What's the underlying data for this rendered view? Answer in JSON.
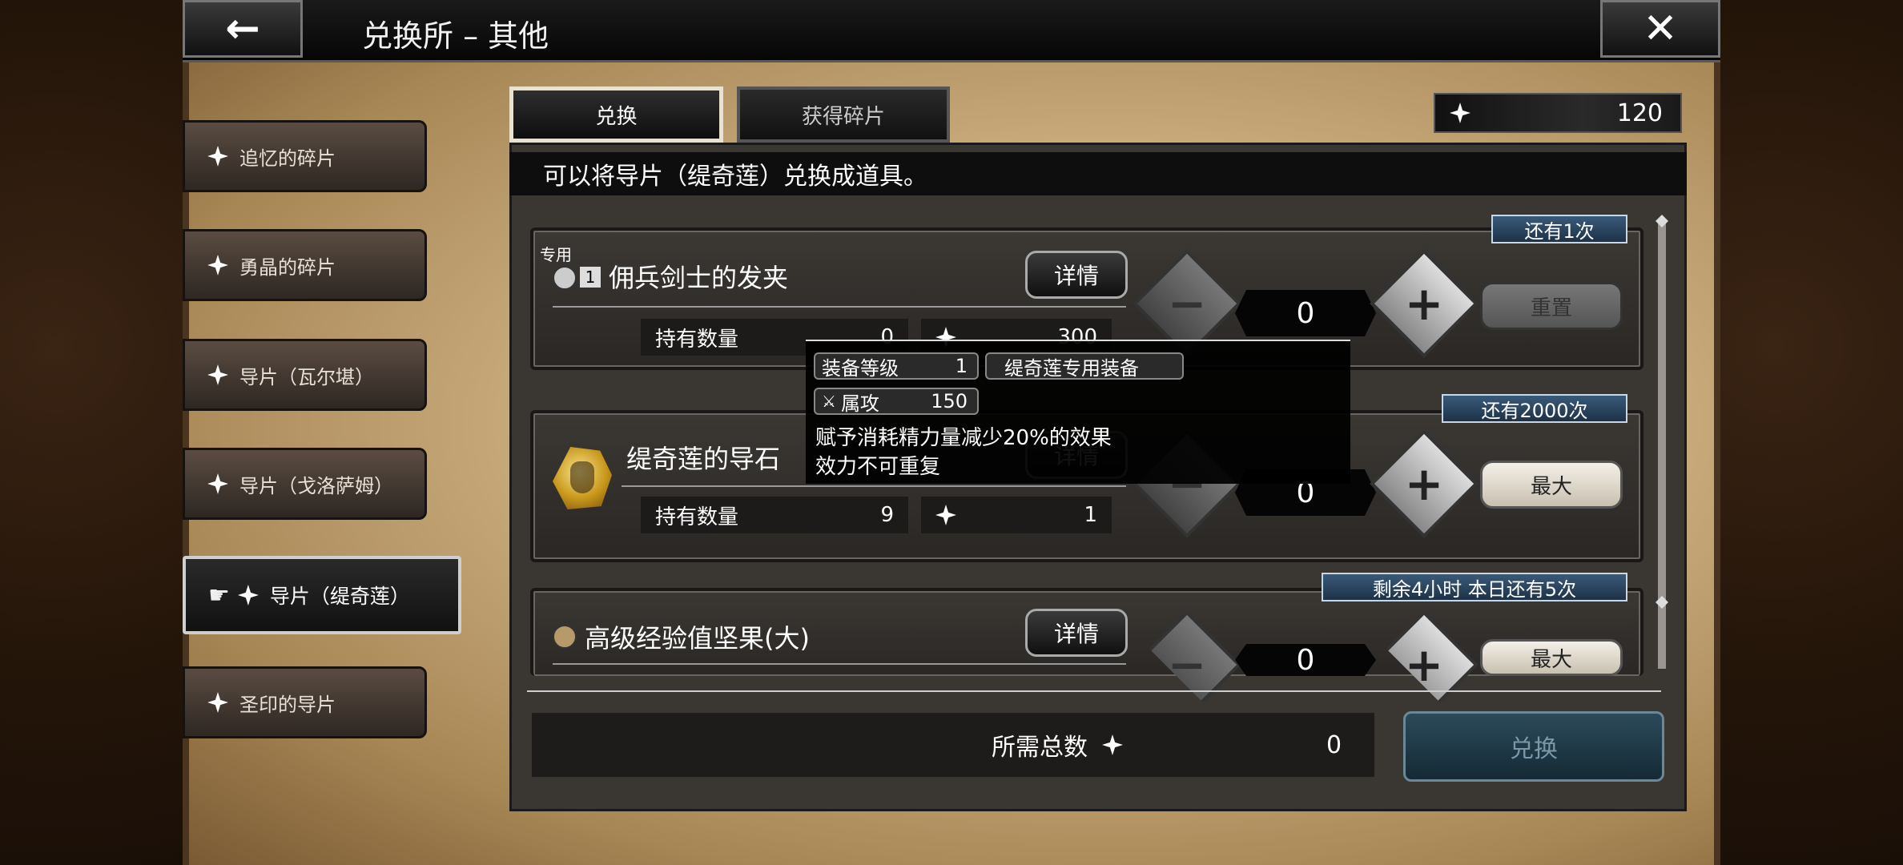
{
  "header": {
    "back_icon": "←",
    "title": "兑换所 – 其他",
    "close_icon": "✕"
  },
  "sidebar": {
    "items": [
      {
        "label": "追忆的碎片"
      },
      {
        "label": "勇晶的碎片"
      },
      {
        "label": "导片（瓦尔堪）"
      },
      {
        "label": "导片（戈洛萨姆）"
      },
      {
        "label": "导片（缇奇莲）",
        "active": true
      },
      {
        "label": "圣印的导片"
      }
    ]
  },
  "tabs": {
    "exchange": "兑换",
    "get_shards": "获得碎片"
  },
  "currency": {
    "amount": "120"
  },
  "instruction": "可以将导片（缇奇莲）兑换成道具。",
  "rows": [
    {
      "exclusive_label": "专用",
      "rank": "1",
      "name": "佣兵剑士的发夹",
      "remaining": "还有1次",
      "detail_label": "详情",
      "owned_label": "持有数量",
      "owned_value": "0",
      "cost": "300",
      "counter": "0",
      "action_label": "重置"
    },
    {
      "name": "缇奇莲的导石",
      "remaining": "还有2000次",
      "detail_label": "详情",
      "owned_label": "持有数量",
      "owned_value": "9",
      "cost": "1",
      "counter": "0",
      "action_label": "最大"
    },
    {
      "name": "高级经验值坚果(大)",
      "remaining": "剩余4小时  本日还有5次",
      "detail_label": "详情",
      "counter": "0",
      "action_label": "最大"
    }
  ],
  "tooltip": {
    "equip_level_label": "装备等级",
    "equip_level_value": "1",
    "exclusive_label": "缇奇莲专用装备",
    "attr_label": "属攻",
    "attr_value": "150",
    "effect_line1": "赋予消耗精力量减少20%的效果",
    "effect_line2": "效力不可重复"
  },
  "footer": {
    "total_label": "所需总数",
    "total_value": "0",
    "exchange_label": "兑换"
  }
}
